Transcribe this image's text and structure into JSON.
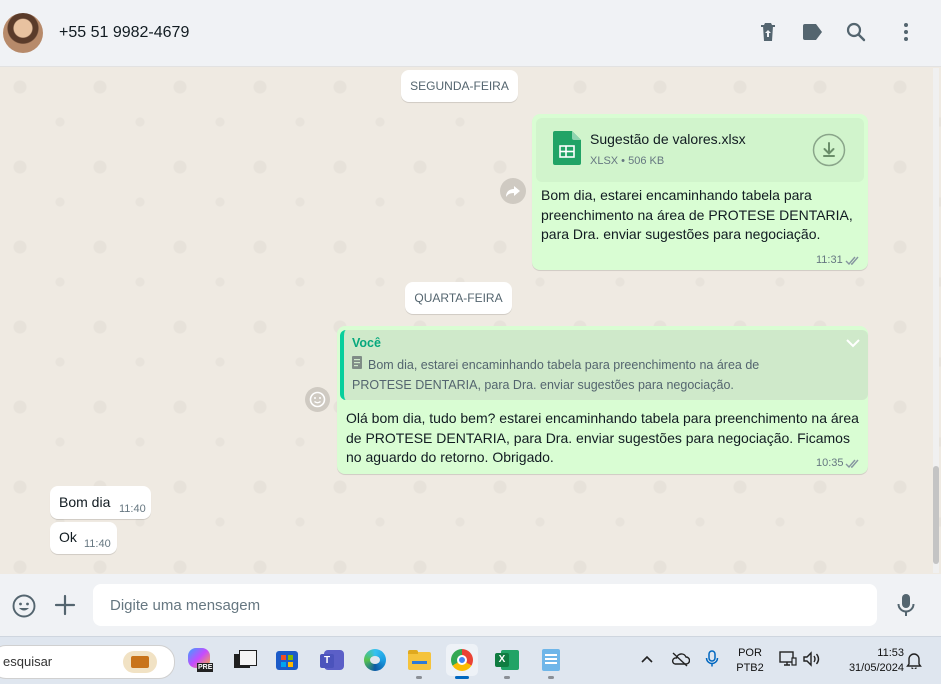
{
  "header": {
    "contact_name": "+55 51 9982-4679",
    "icons": [
      "delete-icon",
      "label-icon",
      "search-icon",
      "more-options-icon"
    ]
  },
  "chat": {
    "day_separators": [
      "SEGUNDA-FEIRA",
      "QUARTA-FEIRA"
    ],
    "file_message": {
      "file_name": "Sugestão de valores.xlsx",
      "file_meta": "XLSX • 506 KB",
      "text": "Bom dia, estarei encaminhando tabela para preenchimento na área de PROTESE DENTARIA, para Dra. enviar sugestões para negociação.",
      "time": "11:31"
    },
    "reply_message": {
      "quote_author": "Você",
      "quote_text": "Bom dia, estarei encaminhando tabela para preenchimento na área de PROTESE DENTARIA, para Dra. enviar sugestões para negociação.",
      "text": "Olá bom dia, tudo bem? estarei encaminhando tabela para preenchimento na área de PROTESE DENTARIA, para Dra. enviar sugestões para negociação. Ficamos no aguardo do retorno. Obrigado.",
      "time": "10:35"
    },
    "incoming": [
      {
        "text": "Bom dia",
        "time": "11:40"
      },
      {
        "text": "Ok",
        "time": "11:40"
      }
    ]
  },
  "composer": {
    "placeholder": "Digite uma mensagem"
  },
  "taskbar": {
    "search_label": "esquisar",
    "copilot_badge": "PRE",
    "language_line1": "POR",
    "language_line2": "PTB2",
    "clock_time": "11:53",
    "clock_date": "31/05/2024"
  },
  "colors": {
    "outgoing_bubble": "#d9fdd3",
    "incoming_bubble": "#ffffff",
    "accent_green": "#06cf9c",
    "chat_background": "#efeae2"
  }
}
